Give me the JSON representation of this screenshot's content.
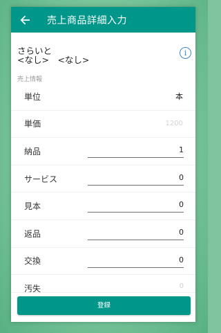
{
  "appbar": {
    "title": "売上商品詳細入力"
  },
  "customer": {
    "line1": "さらいと",
    "line2": "<なし>　<なし>",
    "info_icon": "info-icon"
  },
  "section_label": "売上情報",
  "rows": [
    {
      "label": "単位",
      "value": "本"
    },
    {
      "label": "単価",
      "value": "1200"
    },
    {
      "label": "納品",
      "value": "1"
    },
    {
      "label": "サービス",
      "value": "0"
    },
    {
      "label": "見本",
      "value": "0"
    },
    {
      "label": "返品",
      "value": "0"
    },
    {
      "label": "交換",
      "value": "0"
    },
    {
      "label": "汚失",
      "value": "0"
    }
  ],
  "footer": {
    "register_label": "登録"
  },
  "colors": {
    "accent": "#00968a",
    "info": "#3c86c9"
  }
}
